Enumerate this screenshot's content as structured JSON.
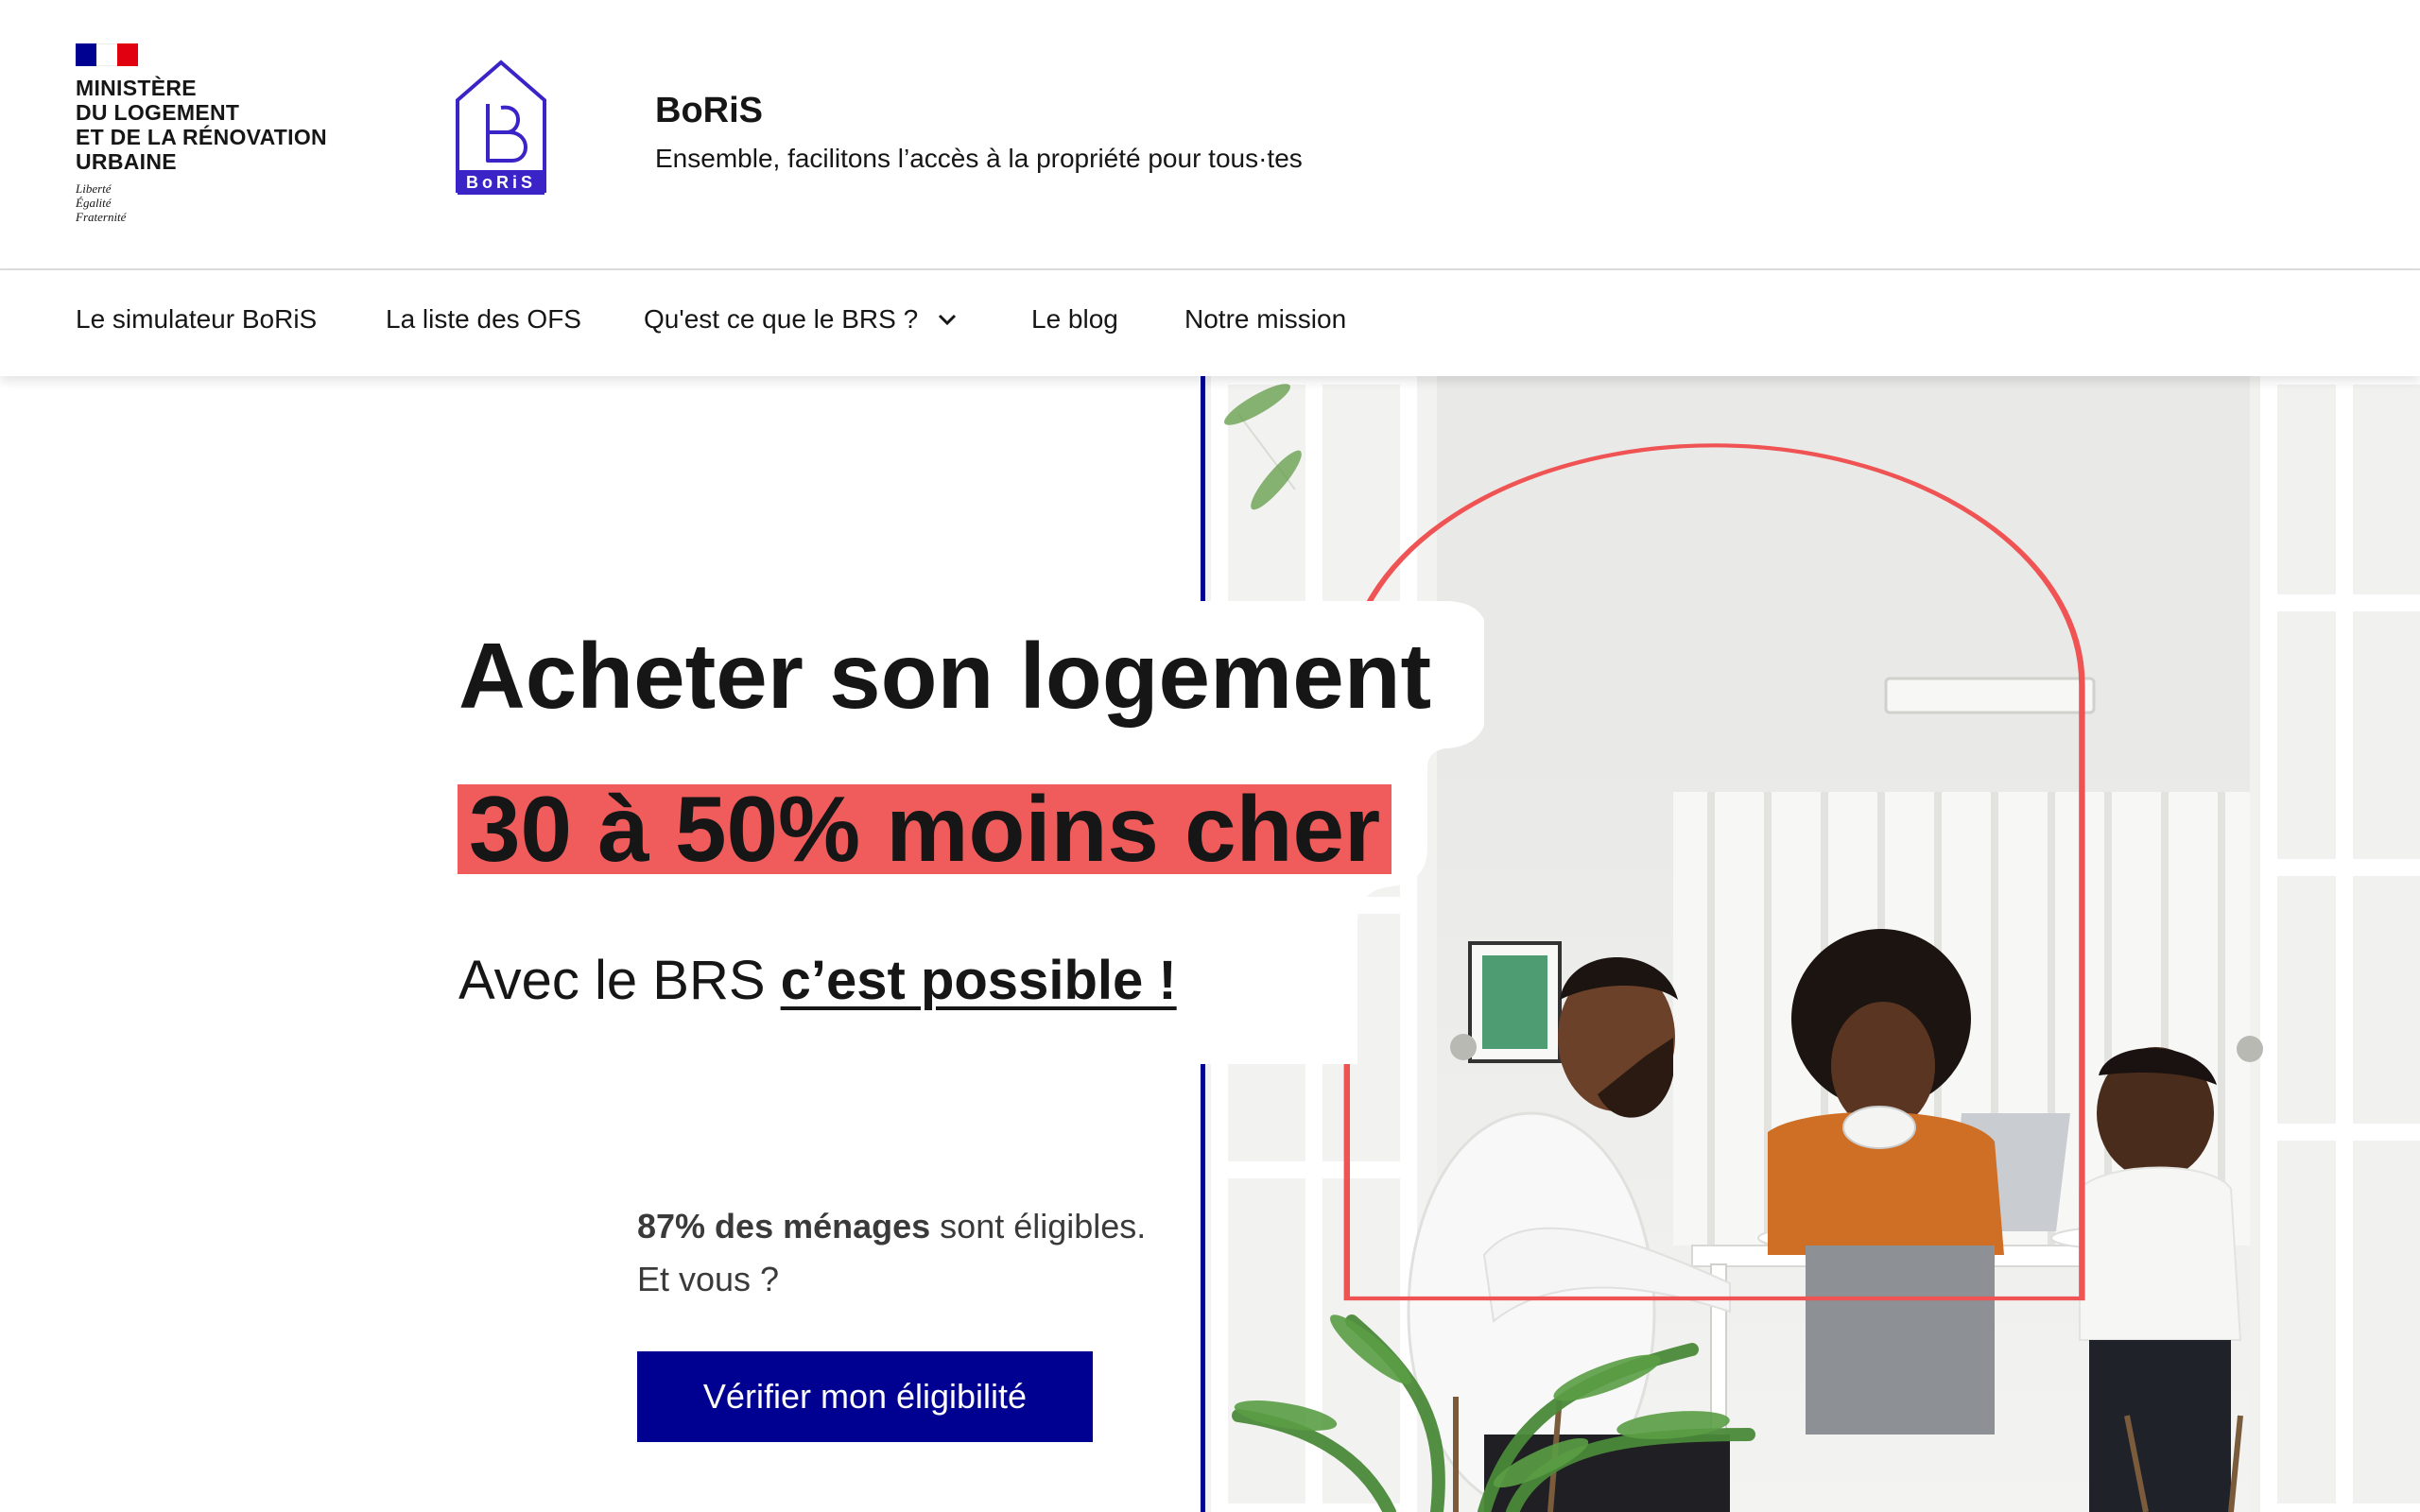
{
  "header": {
    "ministry": "MINISTÈRE\nDU LOGEMENT\nET DE LA RÉNOVATION\nURBAINE",
    "devise": "Liberté\nÉgalité\nFraternité",
    "logo_text": "BoRiS",
    "site_title": "BoRiS",
    "tagline": "Ensemble, facilitons l’accès à la propriété pour tous·tes",
    "colors": {
      "flag_blue": "#000091",
      "flag_red": "#e1000f",
      "brand": "#000091"
    }
  },
  "nav": {
    "items": [
      {
        "label": "Le simulateur BoRiS"
      },
      {
        "label": "La liste des OFS"
      },
      {
        "label": "Qu'est ce que le BRS ?",
        "icon": "chevron-down-icon"
      },
      {
        "label": "Le blog"
      },
      {
        "label": "Notre mission"
      }
    ]
  },
  "hero": {
    "title": "Acheter son logement",
    "highlight": "30 à 50% moins cher",
    "subtitle_prefix": "Avec le BRS ",
    "subtitle_strong": "c’est possible !",
    "stat_strong": "87% des ménages",
    "stat_rest": " sont éligibles.",
    "stat_question": "Et vous ?",
    "cta_label": "Vérifier mon éligibilité",
    "colors": {
      "highlight": "#f05b5b",
      "arch": "#ef5353"
    }
  }
}
